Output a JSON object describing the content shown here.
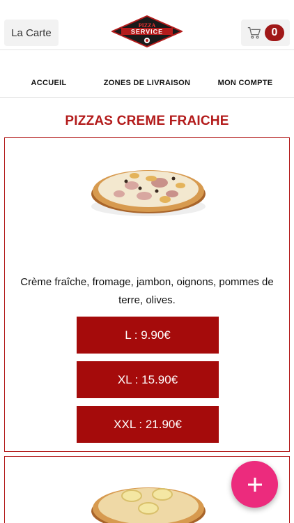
{
  "header": {
    "menu_label": "La Carte",
    "logo_text_top": "PIZZA",
    "logo_text_main": "SERVICE",
    "cart_count": "0"
  },
  "nav": {
    "items": [
      "ACCUEIL",
      "ZONES DE LIVRAISON",
      "MON COMPTE"
    ]
  },
  "section": {
    "title": "PIZZAS CREME FRAICHE"
  },
  "products": [
    {
      "description": "Crème fraîche, fromage, jambon, oignons, pommes de terre, olives.",
      "prices": [
        "L : 9.90€",
        "XL : 15.90€",
        "XXL : 21.90€"
      ]
    }
  ],
  "colors": {
    "brand_red": "#b31b1b",
    "button_red": "#a50b0b",
    "fab_pink": "#ec2b7d"
  },
  "icons": {
    "cart": "cart-icon",
    "fab": "plus-icon"
  }
}
